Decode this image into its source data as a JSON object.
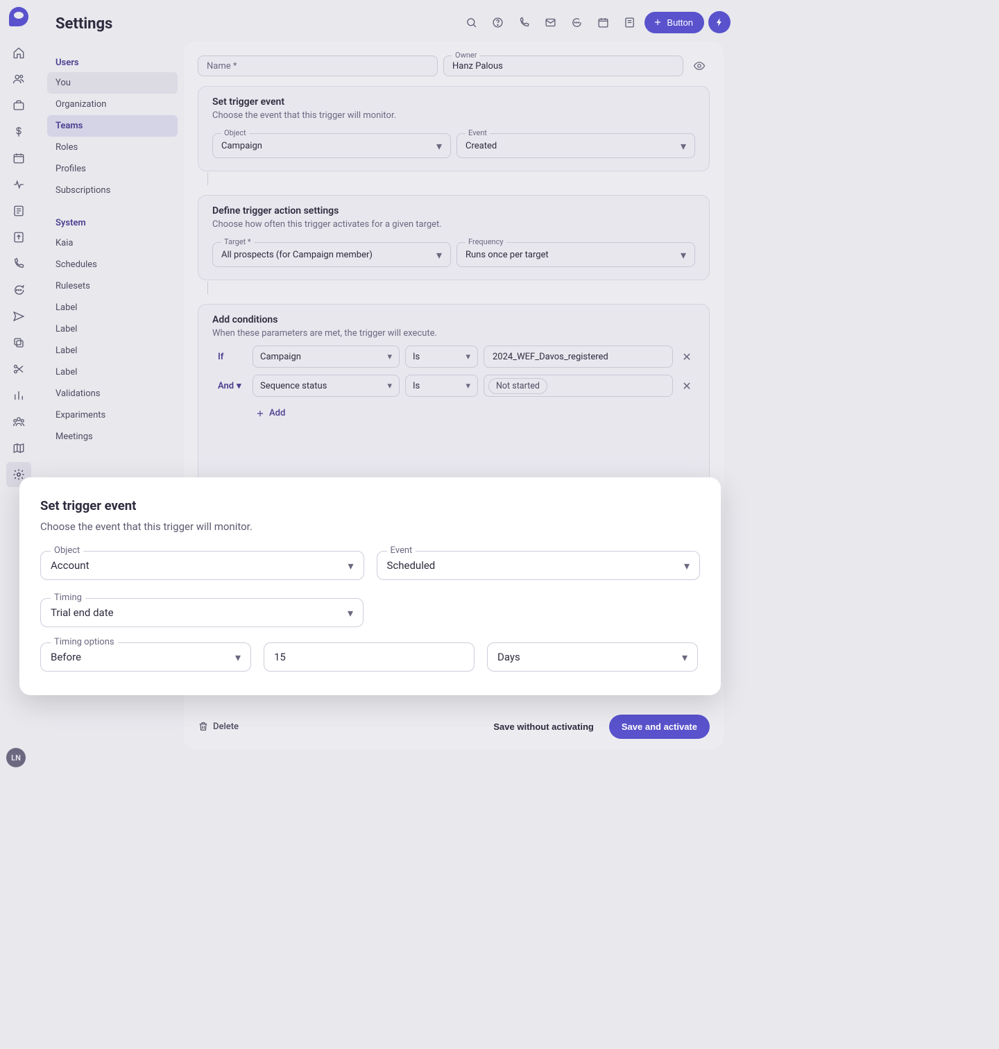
{
  "page": {
    "title": "Settings"
  },
  "avatar": "LN",
  "topButton": {
    "label": "Button"
  },
  "sidebar": {
    "users": {
      "header": "Users",
      "items": [
        "You",
        "Organization",
        "Teams",
        "Roles",
        "Profiles",
        "Subscriptions"
      ]
    },
    "system": {
      "header": "System",
      "items": [
        "Kaia",
        "Schedules",
        "Rulesets",
        "Label",
        "Label",
        "Label",
        "Label",
        "Validations",
        "Expariments",
        "Meetings"
      ]
    }
  },
  "nameField": {
    "label": "Name *",
    "value": ""
  },
  "ownerField": {
    "label": "Owner",
    "value": "Hanz Palous"
  },
  "triggerEvent": {
    "title": "Set trigger event",
    "sub": "Choose the event that this trigger will monitor.",
    "objectLabel": "Object",
    "objectValue": "Campaign",
    "eventLabel": "Event",
    "eventValue": "Created"
  },
  "actionSettings": {
    "title": "Define trigger action settings",
    "sub": "Choose how often this trigger activates for a given target.",
    "targetLabel": "Target *",
    "targetValue": "All prospects (for Campaign member)",
    "freqLabel": "Frequency",
    "freqValue": "Runs once per target"
  },
  "conditions": {
    "title": "Add conditions",
    "sub": "When these parameters are met, the trigger will execute.",
    "ifLabel": "If",
    "andLabel": "And",
    "addLabel": "Add",
    "rows": [
      {
        "field": "Campaign",
        "op": "Is",
        "val": "2024_WEF_Davos_registered",
        "chip": false
      },
      {
        "field": "Sequence status",
        "op": "Is",
        "val": "Not started",
        "chip": true
      }
    ]
  },
  "modal": {
    "title": "Set trigger event",
    "sub": "Choose the event that this trigger will monitor.",
    "objectLabel": "Object",
    "objectValue": "Account",
    "eventLabel": "Event",
    "eventValue": "Scheduled",
    "timingLabel": "Timing",
    "timingValue": "Trial end date",
    "optLabel": "Timing options",
    "optValue": "Before",
    "numValue": "15",
    "unitValue": "Days"
  },
  "footer": {
    "delete": "Delete",
    "saveWithout": "Save without activating",
    "saveActivate": "Save and activate"
  }
}
